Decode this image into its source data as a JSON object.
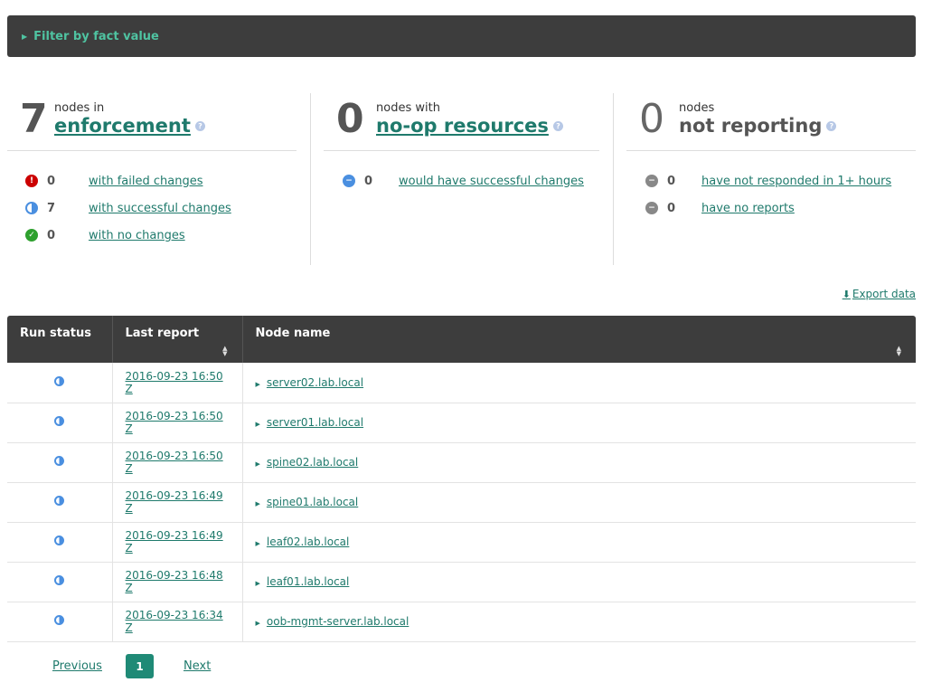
{
  "filter": {
    "label": "Filter by fact value"
  },
  "summary": [
    {
      "count": "7",
      "caption": "nodes in",
      "title": "enforcement",
      "rows": [
        {
          "num": "0",
          "label": "with failed changes"
        },
        {
          "num": "7",
          "label": "with successful changes"
        },
        {
          "num": "0",
          "label": "with no changes"
        }
      ]
    },
    {
      "count": "0",
      "caption": "nodes with",
      "title": "no-op resources",
      "rows": [
        {
          "num": "0",
          "label": "would have successful changes"
        }
      ]
    },
    {
      "count": "0",
      "caption": "nodes",
      "title": "not reporting",
      "rows": [
        {
          "num": "0",
          "label": "have not responded in 1+ hours"
        },
        {
          "num": "0",
          "label": "have no reports"
        }
      ]
    }
  ],
  "export_label": "Export data",
  "table": {
    "headers": [
      "Run status",
      "Last report",
      "Node name"
    ],
    "rows": [
      {
        "report": "2016-09-23 16:50 Z",
        "node": "server02.lab.local"
      },
      {
        "report": "2016-09-23 16:50 Z",
        "node": "server01.lab.local"
      },
      {
        "report": "2016-09-23 16:50 Z",
        "node": "spine02.lab.local"
      },
      {
        "report": "2016-09-23 16:49 Z",
        "node": "spine01.lab.local"
      },
      {
        "report": "2016-09-23 16:49 Z",
        "node": "leaf02.lab.local"
      },
      {
        "report": "2016-09-23 16:48 Z",
        "node": "leaf01.lab.local"
      },
      {
        "report": "2016-09-23 16:34 Z",
        "node": "oob-mgmt-server.lab.local"
      }
    ]
  },
  "pager": {
    "previous": "Previous",
    "current": "1",
    "next": "Next"
  },
  "colors": {
    "accent": "#1f7a6c",
    "header_bg": "#3d3d3d",
    "failed": "#cc0000",
    "success": "#2ea02e",
    "noop": "#4a8fe0"
  }
}
